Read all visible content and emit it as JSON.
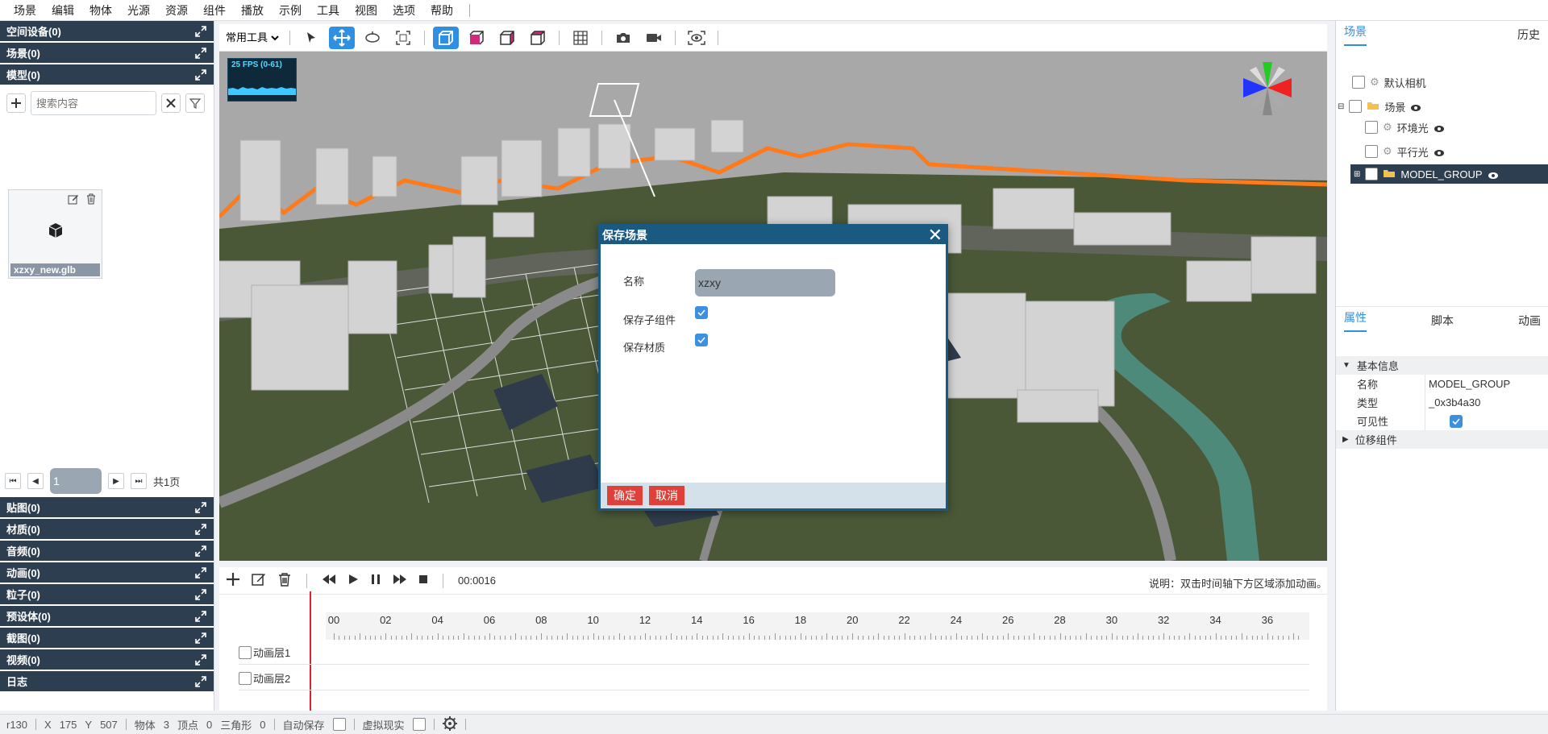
{
  "menu": [
    "场景",
    "编辑",
    "物体",
    "光源",
    "资源",
    "组件",
    "播放",
    "示例",
    "工具",
    "视图",
    "选项",
    "帮助"
  ],
  "left": {
    "top_sections": [
      "空间设备(0)",
      "场景(0)",
      "模型(0)"
    ],
    "search_placeholder": "搜索内容",
    "asset_name": "xzxy_new.glb",
    "page_value": "1",
    "page_total": "共1页",
    "bottom_sections": [
      "贴图(0)",
      "材质(0)",
      "音频(0)",
      "动画(0)",
      "粒子(0)",
      "预设体(0)",
      "截图(0)",
      "视频(0)",
      "日志"
    ]
  },
  "viewport": {
    "tool_select": "常用工具",
    "fps_text": "25 FPS (0-61)"
  },
  "dialog": {
    "title": "保存场景",
    "name_label": "名称",
    "name_value": "xzxy",
    "save_children_label": "保存子组件",
    "save_children_checked": true,
    "save_material_label": "保存材质",
    "save_material_checked": true,
    "ok_label": "确定",
    "cancel_label": "取消"
  },
  "timeline": {
    "time": "00:0016",
    "hint": "说明：双击时间轴下方区域添加动画。",
    "ticks": [
      "00",
      "02",
      "04",
      "06",
      "08",
      "10",
      "12",
      "14",
      "16",
      "18",
      "20",
      "22",
      "24",
      "26",
      "28",
      "30",
      "32",
      "34",
      "36"
    ],
    "layers": [
      "动画层1",
      "动画层2"
    ]
  },
  "right": {
    "tabs_top": [
      "场景",
      "历史"
    ],
    "tree": [
      {
        "label": "默认相机",
        "level": 0
      },
      {
        "label": "场景",
        "level": 0
      },
      {
        "label": "环境光",
        "level": 1
      },
      {
        "label": "平行光",
        "level": 1
      },
      {
        "label": "MODEL_GROUP",
        "level": 1
      }
    ],
    "tabs_bottom": [
      "属性",
      "脚本",
      "动画"
    ],
    "section_basic": "基本信息",
    "prop_name_key": "名称",
    "prop_name_val": "MODEL_GROUP",
    "prop_type_key": "类型",
    "prop_type_val": "_0x3b4a30",
    "prop_visible_key": "可见性",
    "section_transform": "位移组件"
  },
  "status": {
    "rev": "r130",
    "x_label": "X",
    "x_val": "175",
    "y_label": "Y",
    "y_val": "507",
    "obj_label": "物体",
    "obj_val": "3",
    "vert_label": "顶点",
    "vert_val": "0",
    "tri_label": "三角形",
    "tri_val": "0",
    "autosave": "自动保存",
    "vr": "虚拟现实"
  },
  "colors": {
    "accent": "#2f8fe0",
    "header": "#2d3e50",
    "dialog": "#1a5a80",
    "danger": "#e0403a",
    "highlight": "#ff7a1a"
  }
}
